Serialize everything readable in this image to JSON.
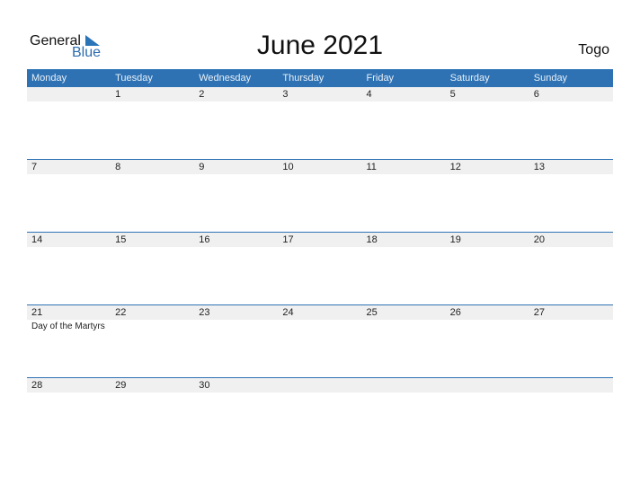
{
  "logo": {
    "word1": "General",
    "word2": "Blue"
  },
  "title": "June 2021",
  "country": "Togo",
  "weekdays": [
    "Monday",
    "Tuesday",
    "Wednesday",
    "Thursday",
    "Friday",
    "Saturday",
    "Sunday"
  ],
  "weeks": [
    {
      "dates": [
        "",
        "1",
        "2",
        "3",
        "4",
        "5",
        "6"
      ],
      "events": [
        "",
        "",
        "",
        "",
        "",
        "",
        ""
      ]
    },
    {
      "dates": [
        "7",
        "8",
        "9",
        "10",
        "11",
        "12",
        "13"
      ],
      "events": [
        "",
        "",
        "",
        "",
        "",
        "",
        ""
      ]
    },
    {
      "dates": [
        "14",
        "15",
        "16",
        "17",
        "18",
        "19",
        "20"
      ],
      "events": [
        "",
        "",
        "",
        "",
        "",
        "",
        ""
      ]
    },
    {
      "dates": [
        "21",
        "22",
        "23",
        "24",
        "25",
        "26",
        "27"
      ],
      "events": [
        "Day of the Martyrs",
        "",
        "",
        "",
        "",
        "",
        ""
      ]
    },
    {
      "dates": [
        "28",
        "29",
        "30",
        "",
        "",
        "",
        ""
      ],
      "events": [
        "",
        "",
        "",
        "",
        "",
        "",
        ""
      ]
    }
  ],
  "colors": {
    "header": "#2e72b4",
    "row_shade": "#f0f0f0"
  }
}
